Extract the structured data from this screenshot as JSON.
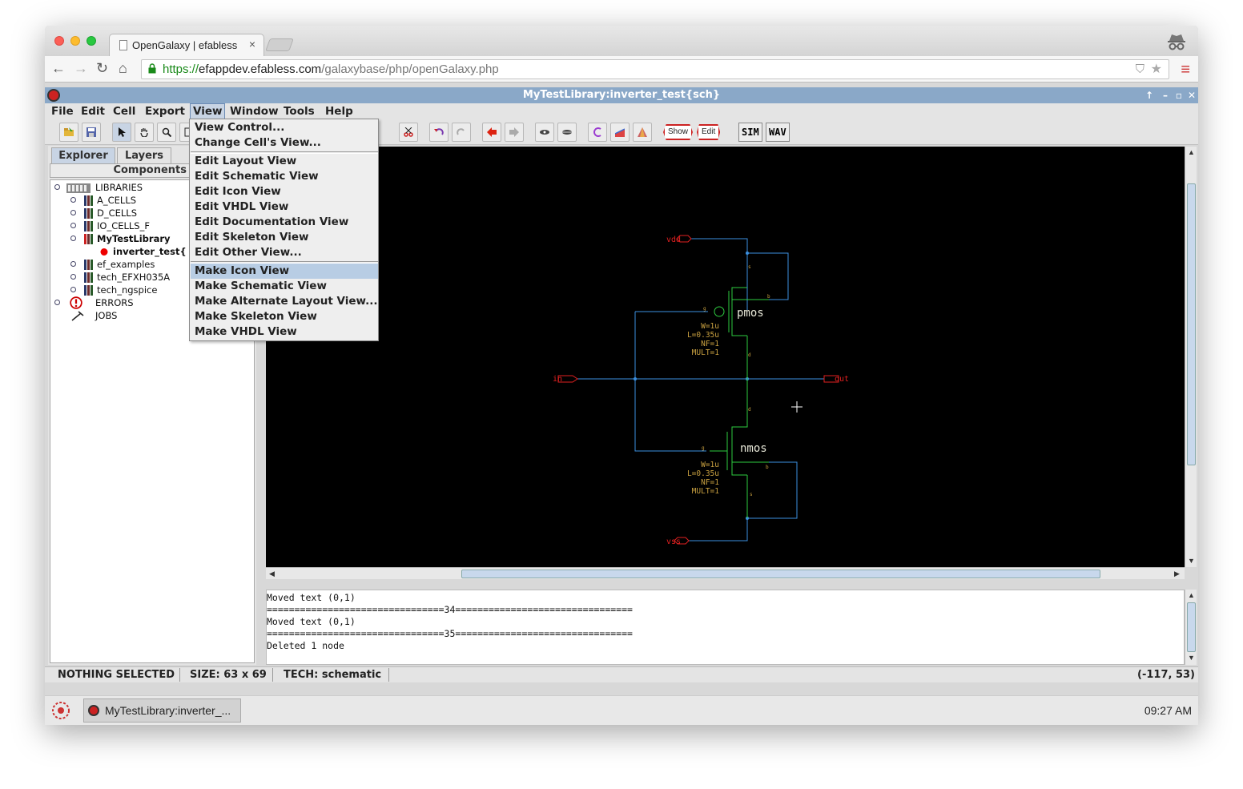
{
  "browser": {
    "tab_title": "OpenGalaxy | efabless",
    "tab_close": "×",
    "url_scheme": "https://",
    "url_host": "efappdev.efabless.com",
    "url_path": "/galaxybase/php/openGalaxy.php",
    "back": "←",
    "forward": "→",
    "reload": "↻",
    "home": "⌂",
    "menu_icon": "≡",
    "star_icon": "★",
    "shield_icon": "⛉"
  },
  "app": {
    "window_title": "MyTestLibrary:inverter_test{sch}",
    "window_controls": [
      "↑",
      "–",
      "▫",
      "✕"
    ]
  },
  "menubar": {
    "file": "File",
    "edit": "Edit",
    "cell": "Cell",
    "export": "Export",
    "view": "View",
    "window": "Window",
    "tools": "Tools",
    "help": "Help"
  },
  "toolbar": {
    "show_label": "Show",
    "edit_label": "Edit",
    "sim_label": "SIM",
    "wav_label": "WAV"
  },
  "view_menu": {
    "items": [
      "View Control...",
      "Change Cell's View...",
      "Edit Layout View",
      "Edit Schematic View",
      "Edit Icon View",
      "Edit VHDL View",
      "Edit Documentation View",
      "Edit Skeleton View",
      "Edit Other View...",
      "Make Icon View",
      "Make Schematic View",
      "Make Alternate Layout View...",
      "Make Skeleton View",
      "Make VHDL View"
    ],
    "selected": "Make Icon View"
  },
  "explorer": {
    "tab_explorer": "Explorer",
    "tab_layers": "Layers",
    "components_header": "Components",
    "tree": [
      "LIBRARIES",
      "A_CELLS",
      "D_CELLS",
      "IO_CELLS_F",
      "MyTestLibrary",
      "inverter_test{",
      "ef_examples",
      "tech_EFXH035A",
      "tech_ngspice",
      "ERRORS",
      "JOBS"
    ]
  },
  "schematic": {
    "vdd_label": "vdd",
    "vss_label": "vss",
    "in_label": "in",
    "out_label": "out",
    "pmos_label": "pmos",
    "nmos_label": "nmos",
    "pmos_params": [
      "W=1u",
      "L=0.35u",
      "NF=1",
      "MULT=1"
    ],
    "nmos_params": [
      "W=1u",
      "L=0.35u",
      "NF=1",
      "MULT=1"
    ],
    "terminal_letters": {
      "source": "s",
      "bulk": "b",
      "gate": "g",
      "drain": "d"
    }
  },
  "messages": [
    "Moved text (0,1)",
    "================================34================================",
    "Moved text (0,1)",
    "================================35================================",
    "Deleted 1 node"
  ],
  "status": {
    "selection": "NOTHING SELECTED",
    "size": "SIZE: 63 x 69",
    "tech": "TECH: schematic",
    "coords": "(-117, 53)"
  },
  "taskbar": {
    "app_title": "MyTestLibrary:inverter_...",
    "clock": "09:27 AM"
  },
  "colors": {
    "wire": "#3b8fe0",
    "device": "#2ecc40",
    "pin": "#e02020",
    "canvas_bg": "#000000",
    "title_bar": "#8aa8c8"
  }
}
